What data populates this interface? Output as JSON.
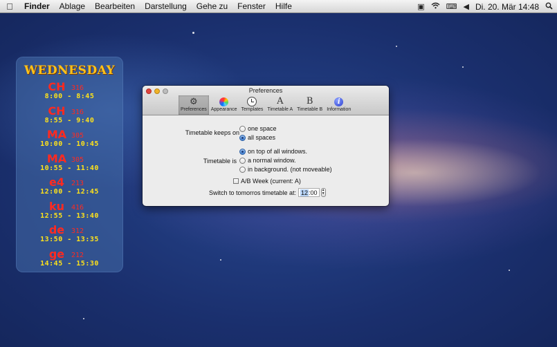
{
  "menubar": {
    "apple_icon": "apple-icon",
    "items": [
      "Finder",
      "Ablage",
      "Bearbeiten",
      "Darstellung",
      "Gehe zu",
      "Fenster",
      "Hilfe"
    ],
    "clock": "Di. 20. Mär  14:48",
    "tray_icons": [
      "window-icon",
      "wifi-icon",
      "keyboard-icon",
      "volume-icon"
    ],
    "search_icon": "spotlight-icon"
  },
  "timetable": {
    "day": "WEDNESDAY",
    "entries": [
      {
        "subject": "CH",
        "room": "316",
        "time": "8:00 - 8:45"
      },
      {
        "subject": "CH",
        "room": "316",
        "time": "8:55 - 9:40"
      },
      {
        "subject": "MA",
        "room": "305",
        "time": "10:00 - 10:45"
      },
      {
        "subject": "MA",
        "room": "305",
        "time": "10:55 - 11:40"
      },
      {
        "subject": "e4",
        "room": "213",
        "time": "12:00 - 12:45"
      },
      {
        "subject": "ku",
        "room": "416",
        "time": "12:55 - 13:40"
      },
      {
        "subject": "de",
        "room": "312",
        "time": "13:50 - 13:35"
      },
      {
        "subject": "ge",
        "room": "212",
        "time": "14:45 - 15:30"
      }
    ]
  },
  "prefs": {
    "title": "Preferences",
    "toolbar": [
      {
        "label": "Preferences",
        "icon": "gear-icon",
        "selected": true
      },
      {
        "label": "Appearance",
        "icon": "color-wheel-icon",
        "selected": false
      },
      {
        "label": "Templates",
        "icon": "clock-icon",
        "selected": false
      },
      {
        "label": "Timetable A",
        "icon": "letter-a-icon",
        "glyph": "A",
        "selected": false
      },
      {
        "label": "Timetable B",
        "icon": "letter-b-icon",
        "glyph": "B",
        "selected": false
      },
      {
        "label": "Information",
        "icon": "info-icon",
        "glyph": "i",
        "selected": false
      }
    ],
    "keeps_on_label": "Timetable keeps on",
    "keeps_on_options": [
      {
        "label": "one space",
        "selected": false
      },
      {
        "label": "all spaces",
        "selected": true
      }
    ],
    "is_label": "Timetable is",
    "is_options": [
      {
        "label": "on top of all windows.",
        "selected": true
      },
      {
        "label": "a normal window.",
        "selected": false
      },
      {
        "label": "in background. (not moveable)",
        "selected": false
      }
    ],
    "ab_week": {
      "label": "A/B Week  (current: A)",
      "checked": false
    },
    "switch_label": "Switch to tomorros timetable at:",
    "switch_hour": "12",
    "switch_minute": "00"
  }
}
